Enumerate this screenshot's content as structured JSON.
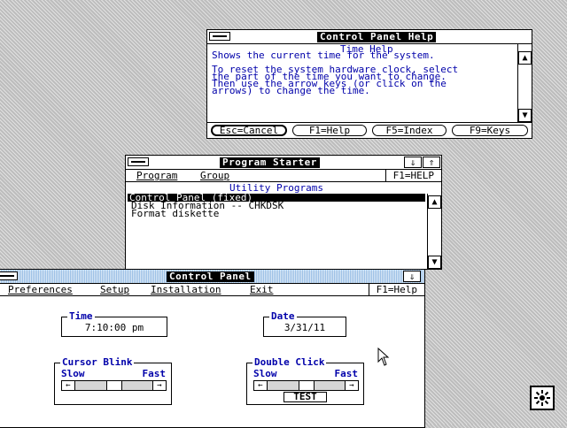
{
  "help_window": {
    "title": "Control Panel Help",
    "heading": "Time Help",
    "lines": [
      "Shows the current time for the system.",
      "",
      "To reset the system hardware clock, select",
      "the part of the time you want to change.",
      "Then use the arrow keys (or click on the",
      "arrows) to change the time."
    ],
    "buttons": [
      "Esc=Cancel",
      "F1=Help",
      "F5=Index",
      "F9=Keys"
    ]
  },
  "program_starter": {
    "title": "Program Starter",
    "menu": [
      "Program",
      "Group"
    ],
    "f1": "F1=HELP",
    "group_title": "Utility Programs",
    "items": [
      "Control Panel (fixed)",
      "Disk Information -- CHKDSK",
      "Format diskette"
    ]
  },
  "control_panel": {
    "title": "Control Panel",
    "menu": [
      "Preferences",
      "Setup",
      "Installation",
      "Exit"
    ],
    "f1": "F1=Help",
    "time": {
      "label": "Time",
      "value": "7:10:00 pm"
    },
    "date": {
      "label": "Date",
      "value": "3/31/11"
    },
    "cursor_blink": {
      "label": "Cursor Blink",
      "slow": "Slow",
      "fast": "Fast"
    },
    "double_click": {
      "label": "Double Click",
      "slow": "Slow",
      "fast": "Fast",
      "test": "TEST"
    }
  },
  "icons": {
    "desktop_icon": "sun-burst-icon",
    "pointer": "mouse-arrow-icon"
  },
  "colors": {
    "help_text": "#0000aa",
    "title_active_bg": "#9cc0e6",
    "title_label_bg": "#000000"
  }
}
